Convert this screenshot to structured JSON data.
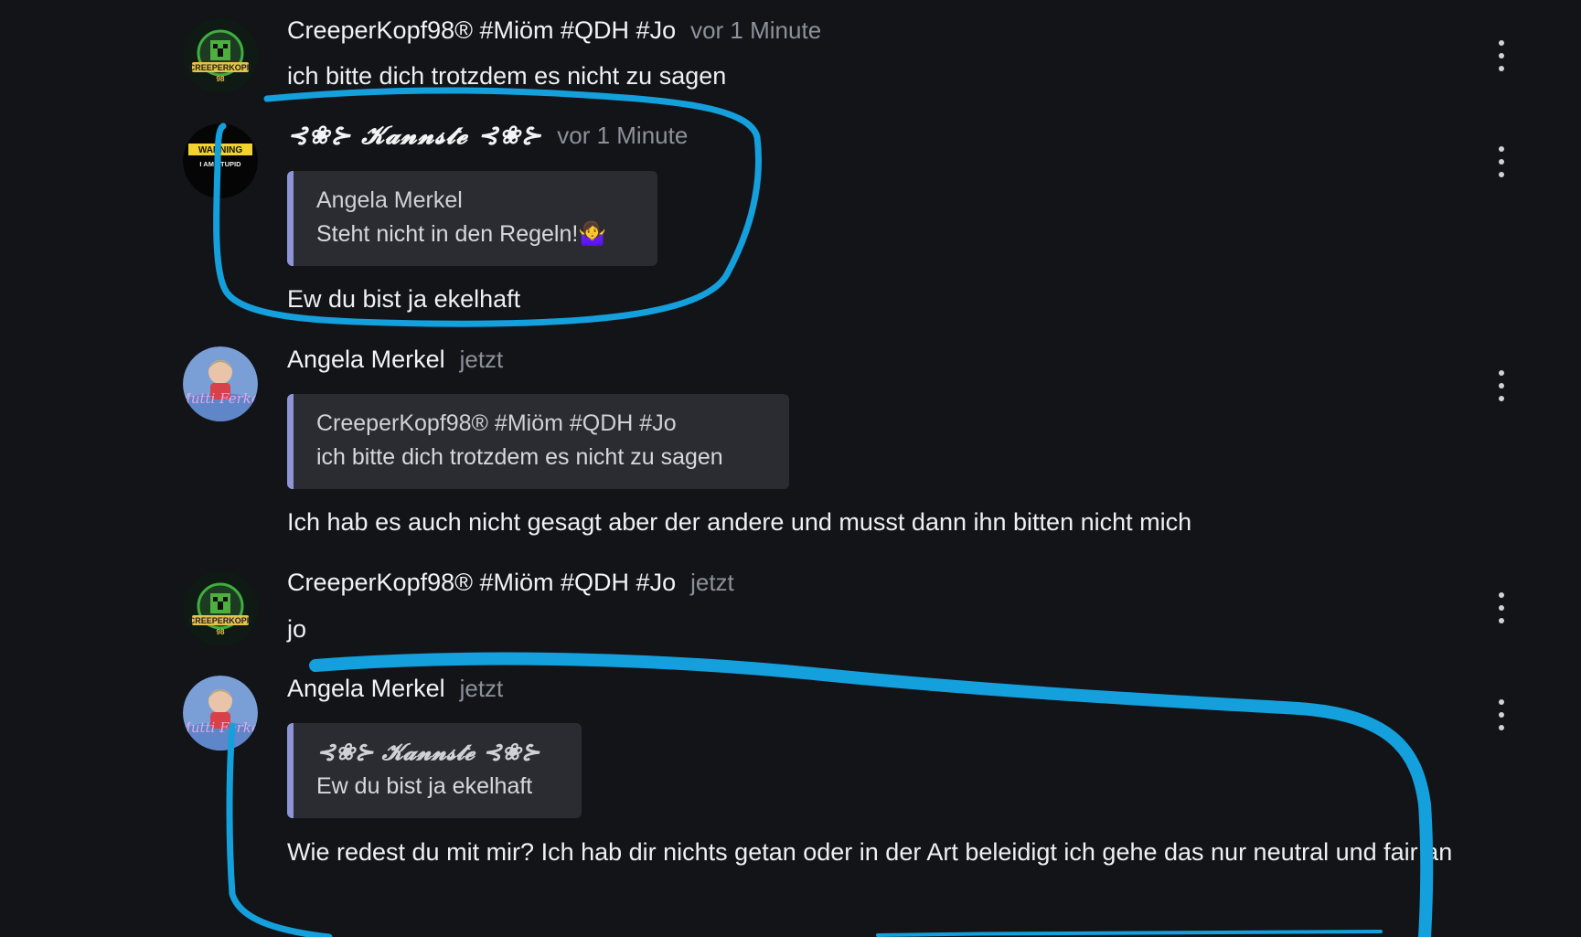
{
  "messages": [
    {
      "author": "CreeperKopf98® #Miöm #QDH #Jo",
      "time": "vor 1 Minute",
      "text": "ich bitte dich trotzdem es nicht zu sagen",
      "avatar": {
        "label": "CREEPERKOPF",
        "sub": "98"
      }
    },
    {
      "author": "𝓚𝓪𝓷𝓷𝓼𝓽𝓮",
      "author_deco_left": "⊰❀⊱",
      "author_deco_right": "⊰❀⊱",
      "time": "vor 1 Minute",
      "quote": {
        "author": "Angela Merkel",
        "text": "Steht nicht in den Regeln!🤷‍♀️"
      },
      "text": "Ew du bist ja ekelhaft",
      "avatar": {
        "label": "WARNING",
        "sub": "I AM STUPID"
      }
    },
    {
      "author": "Angela Merkel",
      "time": "jetzt",
      "quote": {
        "author": "CreeperKopf98® #Miöm #QDH #Jo",
        "text": "ich bitte dich trotzdem es nicht zu sagen"
      },
      "text": "Ich hab es auch nicht gesagt aber der andere und musst dann ihn bitten nicht mich",
      "avatar": {
        "label": "Mutti Ferkel"
      }
    },
    {
      "author": "CreeperKopf98® #Miöm #QDH #Jo",
      "time": "jetzt",
      "text": "jo",
      "avatar": {
        "label": "CREEPERKOPF",
        "sub": "98"
      }
    },
    {
      "author": "Angela Merkel",
      "time": "jetzt",
      "quote": {
        "author": "𝓚𝓪𝓷𝓷𝓼𝓽𝓮",
        "deco_left": "⊰❀⊱",
        "deco_right": "⊰❀⊱",
        "text": "Ew du bist ja ekelhaft"
      },
      "text": "Wie redest du mit mir? Ich hab dir nichts getan oder in der Art beleidigt ich gehe das nur neutral und fair an",
      "avatar": {
        "label": "Mutti Ferkel"
      }
    }
  ],
  "colors": {
    "background": "#121418",
    "quote_bar": "#8d95d6",
    "annotation_stroke": "#14a0dc"
  },
  "icons": {
    "more": "vertical-ellipsis-icon"
  }
}
